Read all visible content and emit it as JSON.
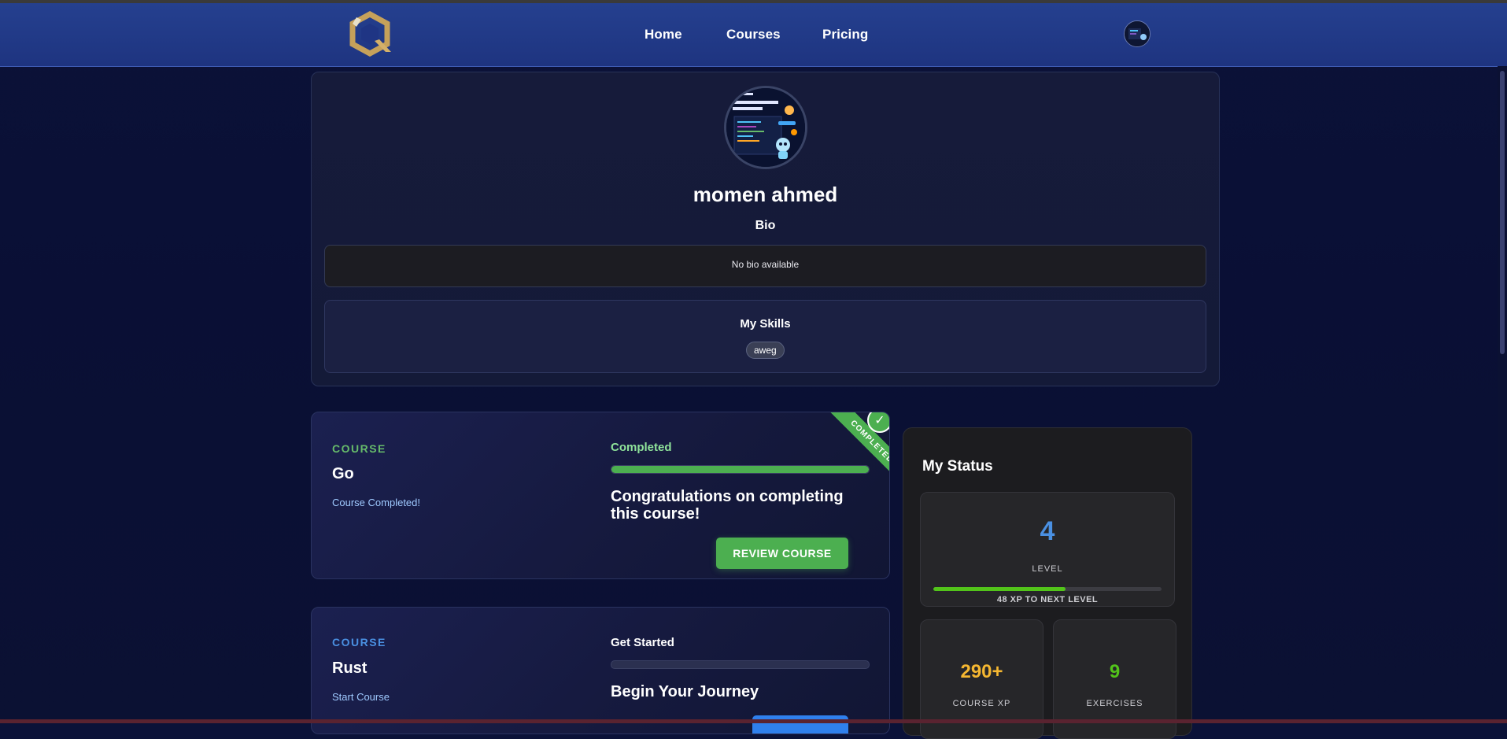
{
  "nav": {
    "links": [
      "Home",
      "Courses",
      "Pricing"
    ]
  },
  "profile": {
    "name": "momen ahmed",
    "bio_label": "Bio",
    "bio_text": "No bio available",
    "skills_title": "My Skills",
    "skills": [
      "aweg"
    ]
  },
  "courses": [
    {
      "kicker": "COURSE",
      "title": "Go",
      "subtitle": "Course Completed!",
      "status": "Completed",
      "progress": 1.0,
      "headline": "Congratulations on completing this course!",
      "button": "REVIEW COURSE",
      "ribbon": "COMPLETED",
      "check": "✓",
      "accent": "#4caf50"
    },
    {
      "kicker": "COURSE",
      "title": "Rust",
      "subtitle": "Start Course",
      "status": "Get Started",
      "progress": 0.0,
      "headline": "Begin Your Journey",
      "accent": "#4a90e2"
    }
  ],
  "status": {
    "title": "My Status",
    "level_value": "4",
    "level_label": "LEVEL",
    "level_progress": 0.58,
    "xp_to_next": "48 XP TO NEXT LEVEL",
    "course_xp_value": "290+",
    "course_xp_label": "COURSE XP",
    "exercises_value": "9",
    "exercises_label": "EXERCISES",
    "colors": {
      "level": "#4a90e2",
      "course_xp": "#f5b731",
      "exercises": "#52c41a"
    }
  }
}
